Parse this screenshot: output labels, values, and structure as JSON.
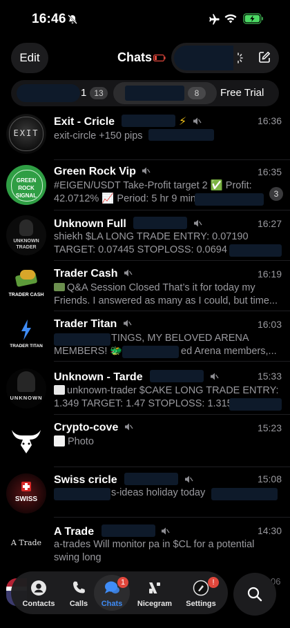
{
  "status": {
    "time": "16:46"
  },
  "header": {
    "edit": "Edit",
    "title": "Chats"
  },
  "filters": [
    {
      "label": "1",
      "count": "13"
    },
    {
      "label": "",
      "count": "8"
    },
    {
      "label": "Free Trial"
    }
  ],
  "chats": [
    {
      "name": "Exit - Cricle",
      "time": "16:36",
      "line1": "exit-circle +150 pips",
      "line2": "",
      "avatar_text": "EXIT"
    },
    {
      "name": "Green Rock Vip",
      "time": "16:35",
      "line1": "#EIGEN/USDT Take-Profit target 2 ✅ Profit:",
      "line2": "42.0712% 📈 Period: 5 hr 9 min",
      "unread": "3",
      "avatar_text": "GREEN ROCK SIGNAL"
    },
    {
      "name": "Unknown Full",
      "time": "16:27",
      "line1": "shiekh $LA LONG TRADE ENTRY: 0.07190",
      "line2": "TARGET: 0.07445 STOPLOSS: 0.0694",
      "avatar_text": "UNKNOWN TRADER"
    },
    {
      "name": "Trader Cash",
      "time": "16:19",
      "line1": "Q&A Session Closed That’s it for today my",
      "line2": "Friends. I answered as many as I could, but time...",
      "avatar_text": "TRADER CASH"
    },
    {
      "name": "Trader Titan",
      "time": "16:03",
      "line1": "TINGS, MY BELOVED ARENA",
      "line2": "MEMBERS! 🐲",
      "line2b": "ed Arena members,...",
      "avatar_text": "TRADER TITAN"
    },
    {
      "name": "Unknown - Tarde",
      "time": "15:33",
      "line1": "unknown-trader $CAKE LONG TRADE ENTRY:",
      "line2": "1.349 TARGET: 1.47 STOPLOSS: 1.315",
      "avatar_text": "UNKNOWN"
    },
    {
      "name": "Crypto-cove",
      "time": "15:23",
      "line1": "Photo",
      "line2": ""
    },
    {
      "name": "Swiss cricle",
      "time": "15:08",
      "line1": "s-ideas holiday today",
      "line2": "",
      "avatar_text": "SWISS"
    },
    {
      "name": "A Trade",
      "time": "14:30",
      "line1": "a-trades Will monitor pa in $CL for a potential",
      "line2": "swing long",
      "avatar_text": "A Trade"
    }
  ],
  "tabs": [
    {
      "label": "Contacts"
    },
    {
      "label": "Calls"
    },
    {
      "label": "Chats",
      "badge": "1"
    },
    {
      "label": "Nicegram"
    },
    {
      "label": "Settings",
      "badge": "!"
    }
  ],
  "colors": {
    "background": "#000000",
    "accent": "#3f8cf6",
    "badge_red": "#e0473c",
    "muted_text": "#9a9a9f"
  }
}
